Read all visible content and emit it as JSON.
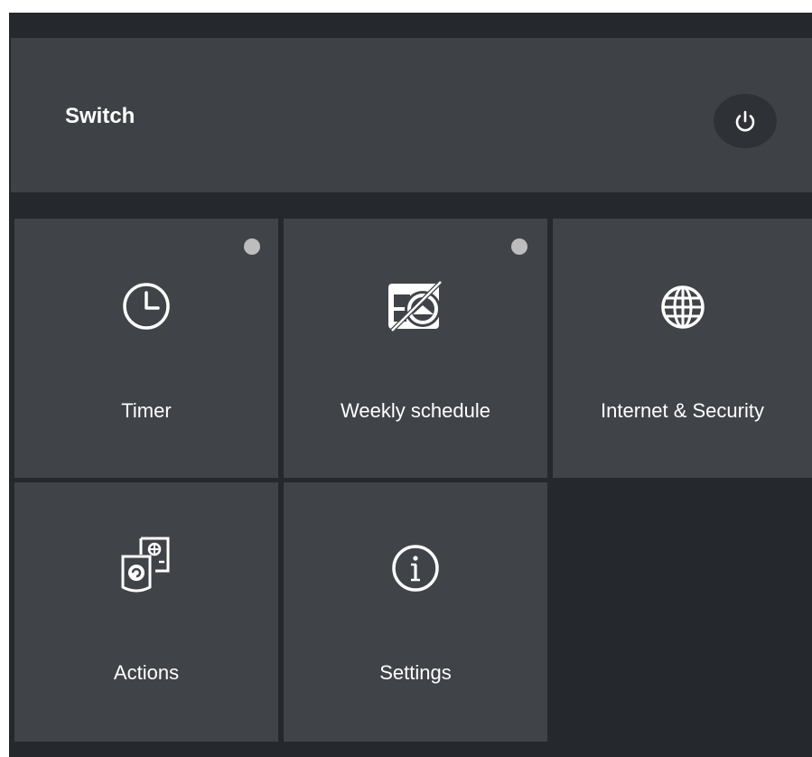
{
  "switch": {
    "label": "Switch",
    "power_icon": "power-icon"
  },
  "tiles": [
    {
      "label": "Timer",
      "icon": "clock-icon",
      "indicator": true
    },
    {
      "label": "Weekly schedule",
      "icon": "calendar-icon",
      "indicator": true
    },
    {
      "label": "Internet & Security",
      "icon": "globe-icon",
      "indicator": false
    },
    {
      "label": "Actions",
      "icon": "actions-icon",
      "indicator": false
    },
    {
      "label": "Settings",
      "icon": "info-icon",
      "indicator": false
    }
  ],
  "colors": {
    "panel": "#25292d",
    "tile": "#404347",
    "switch_bar": "#3e4145",
    "indicator": "#bdbdbd",
    "text": "#ffffff"
  }
}
